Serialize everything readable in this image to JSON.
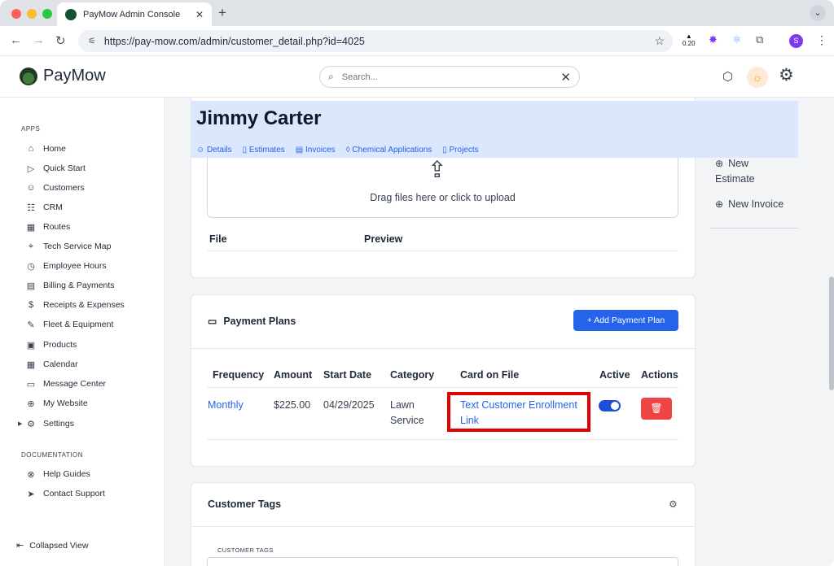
{
  "browser": {
    "tab_title": "PayMow Admin Console",
    "url": "https://pay-mow.com/admin/customer_detail.php?id=4025",
    "ext_badge": "0.20",
    "profile_initial": "S",
    "new_tab": "+",
    "tab_close": "✕"
  },
  "header": {
    "brand": "PayMow",
    "search_placeholder": "Search..."
  },
  "sidebar": {
    "apps_heading": "APPS",
    "items": [
      {
        "label": "Home",
        "icon": "⌂"
      },
      {
        "label": "Quick Start",
        "icon": "▷"
      },
      {
        "label": "Customers",
        "icon": "☺"
      },
      {
        "label": "CRM",
        "icon": "☷"
      },
      {
        "label": "Routes",
        "icon": "▦"
      },
      {
        "label": "Tech Service Map",
        "icon": "⌖"
      },
      {
        "label": "Employee Hours",
        "icon": "◷"
      },
      {
        "label": "Billing & Payments",
        "icon": "▤"
      },
      {
        "label": "Receipts & Expenses",
        "icon": "$"
      },
      {
        "label": "Fleet & Equipment",
        "icon": "✎"
      },
      {
        "label": "Products",
        "icon": "▣"
      },
      {
        "label": "Calendar",
        "icon": "▦"
      },
      {
        "label": "Message Center",
        "icon": "▭"
      },
      {
        "label": "My Website",
        "icon": "⊕"
      },
      {
        "label": "Settings",
        "icon": "⚙"
      }
    ],
    "docs_heading": "DOCUMENTATION",
    "docs": [
      {
        "label": "Help Guides",
        "icon": "⊗"
      },
      {
        "label": "Contact Support",
        "icon": "➤"
      }
    ],
    "collapsed_label": "Collapsed View"
  },
  "customer": {
    "name": "Jimmy Carter",
    "tabs": [
      "Details",
      "Estimates",
      "Invoices",
      "Chemical Applications",
      "Projects"
    ]
  },
  "files": {
    "drop_text": "Drag files here or click to upload",
    "col_file": "File",
    "col_preview": "Preview"
  },
  "payment_plans": {
    "title": "Payment Plans",
    "add_button": "+ Add Payment Plan",
    "columns": [
      "Frequency",
      "Amount",
      "Start Date",
      "Category",
      "Card on File",
      "Active",
      "Actions"
    ],
    "rows": [
      {
        "frequency": "Monthly",
        "amount": "$225.00",
        "start_date": "04/29/2025",
        "category_line1": "Lawn",
        "category_line2": "Service",
        "card_line1": "Text Customer Enrollment",
        "card_line2": "Link",
        "active": true
      }
    ]
  },
  "customer_tags": {
    "title": "Customer Tags",
    "field_label": "CUSTOMER TAGS"
  },
  "right_panel": {
    "new_estimate_line1": "New",
    "new_estimate_line2": "Estimate",
    "new_invoice": "New Invoice"
  },
  "colors": {
    "accent": "#2563eb",
    "hero_bg": "#dbe7fd",
    "delete": "#ef4444",
    "highlight": "#e00000"
  }
}
